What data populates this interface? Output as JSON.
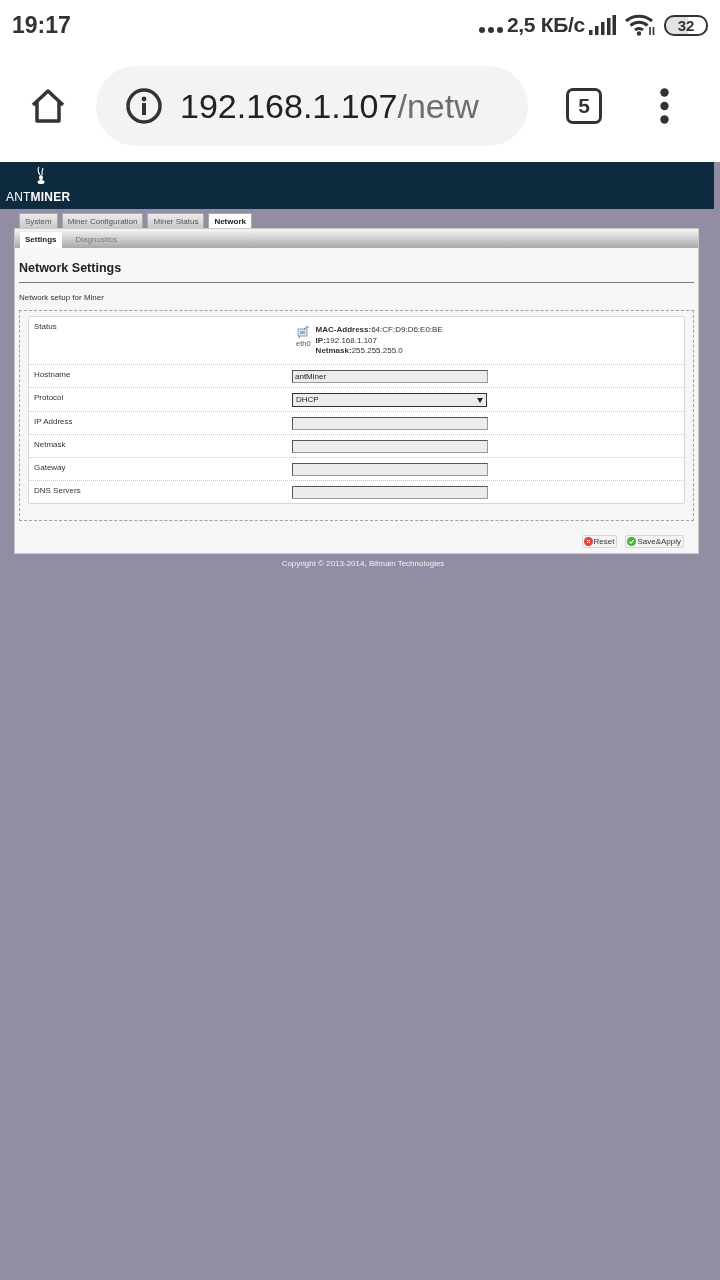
{
  "status_bar": {
    "time": "19:17",
    "network_speed": "2,5 КБ/с",
    "battery": "32"
  },
  "browser": {
    "url_host": "192.168.1.107",
    "url_path": "/netw",
    "tab_count": "5"
  },
  "header": {
    "logo": "ANT**MINER**"
  },
  "tabs": [
    {
      "label": "System",
      "selected": false
    },
    {
      "label": "Miner Configuration",
      "selected": false
    },
    {
      "label": "Miner Status",
      "selected": false
    },
    {
      "label": "Network",
      "selected": true
    }
  ],
  "subtabs": [
    {
      "label": "Settings",
      "selected": true
    },
    {
      "label": "Diagnostics",
      "selected": false
    }
  ],
  "section": {
    "title": "Network Settings",
    "description": "Network setup for Miner"
  },
  "form": {
    "rows": [
      {
        "kind": "status",
        "label": "Status",
        "interface": "eth0",
        "details": [
          "**MAC-Address:**64:CF:D9:D6:E0:BE",
          "**IP:**192.168.1.107",
          "**Netmask:**255.255.255.0"
        ]
      },
      {
        "kind": "text",
        "label": "Hostname",
        "value": "antMiner"
      },
      {
        "kind": "select",
        "label": "Protocol",
        "value": "DHCP"
      },
      {
        "kind": "text",
        "label": "IP Address"
      },
      {
        "kind": "text",
        "label": "Netmask"
      },
      {
        "kind": "text",
        "label": "Gateway"
      },
      {
        "kind": "text",
        "label": "DNS Servers"
      }
    ]
  },
  "buttons": [
    {
      "kind": "reset",
      "label": "Reset"
    },
    {
      "kind": "apply",
      "label": "Save&Apply"
    }
  ],
  "footer": {
    "copyright": "Copyright © 2013-2014, Bitmain Technologies"
  }
}
